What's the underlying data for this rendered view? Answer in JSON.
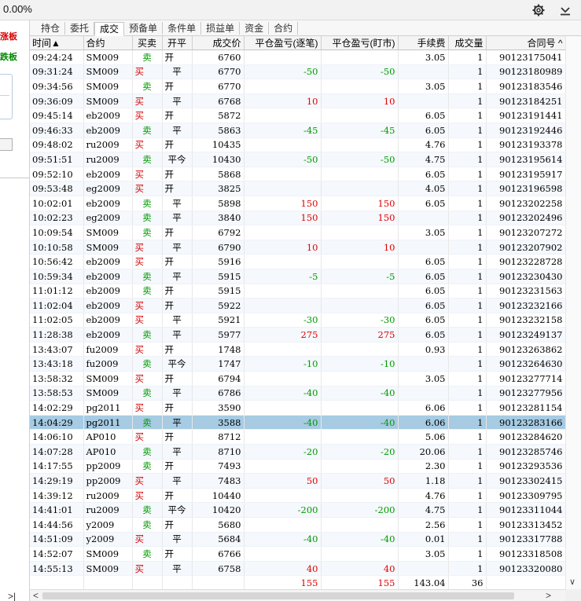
{
  "header": {
    "title": "0.00%"
  },
  "left_panel": {
    "up_label": "涨板",
    "down_label": "跌板",
    "chevron": ">|"
  },
  "tabs": [
    "持仓",
    "委托",
    "成交",
    "预备单",
    "条件单",
    "损益单",
    "资金",
    "合约"
  ],
  "active_tab": 2,
  "columns": [
    "时间▲",
    "合约",
    "买卖",
    "开平",
    "成交价",
    "平仓盈亏(逐笔)",
    "平仓盈亏(盯市)",
    "手续费",
    "成交量",
    "合同号 ^"
  ],
  "rows": [
    [
      "09:24:24",
      "SM009",
      "卖",
      "开",
      "6760",
      "",
      "",
      "3.05",
      "1",
      "90123175041"
    ],
    [
      "09:31:24",
      "SM009",
      "买",
      "平",
      "6770",
      "-50",
      "-50",
      "",
      "1",
      "90123180989"
    ],
    [
      "09:34:56",
      "SM009",
      "卖",
      "开",
      "6770",
      "",
      "",
      "3.05",
      "1",
      "90123183546"
    ],
    [
      "09:36:09",
      "SM009",
      "买",
      "平",
      "6768",
      "10",
      "10",
      "",
      "1",
      "90123184251"
    ],
    [
      "09:45:14",
      "eb2009",
      "买",
      "开",
      "5872",
      "",
      "",
      "6.05",
      "1",
      "90123191441"
    ],
    [
      "09:46:33",
      "eb2009",
      "卖",
      "平",
      "5863",
      "-45",
      "-45",
      "6.05",
      "1",
      "90123192446"
    ],
    [
      "09:48:02",
      "ru2009",
      "买",
      "开",
      "10435",
      "",
      "",
      "4.76",
      "1",
      "90123193378"
    ],
    [
      "09:51:51",
      "ru2009",
      "卖",
      "平今",
      "10430",
      "-50",
      "-50",
      "4.75",
      "1",
      "90123195614"
    ],
    [
      "09:52:10",
      "eb2009",
      "买",
      "开",
      "5868",
      "",
      "",
      "6.05",
      "1",
      "90123195917"
    ],
    [
      "09:53:48",
      "eg2009",
      "买",
      "开",
      "3825",
      "",
      "",
      "4.05",
      "1",
      "90123196598"
    ],
    [
      "10:02:01",
      "eb2009",
      "卖",
      "平",
      "5898",
      "150",
      "150",
      "6.05",
      "1",
      "90123202258"
    ],
    [
      "10:02:23",
      "eg2009",
      "卖",
      "平",
      "3840",
      "150",
      "150",
      "",
      "1",
      "90123202496"
    ],
    [
      "10:09:54",
      "SM009",
      "卖",
      "开",
      "6792",
      "",
      "",
      "3.05",
      "1",
      "90123207272"
    ],
    [
      "10:10:58",
      "SM009",
      "买",
      "平",
      "6790",
      "10",
      "10",
      "",
      "1",
      "90123207902"
    ],
    [
      "10:56:42",
      "eb2009",
      "买",
      "开",
      "5916",
      "",
      "",
      "6.05",
      "1",
      "90123228728"
    ],
    [
      "10:59:34",
      "eb2009",
      "卖",
      "平",
      "5915",
      "-5",
      "-5",
      "6.05",
      "1",
      "90123230430"
    ],
    [
      "11:01:12",
      "eb2009",
      "卖",
      "开",
      "5915",
      "",
      "",
      "6.05",
      "1",
      "90123231563"
    ],
    [
      "11:02:04",
      "eb2009",
      "买",
      "开",
      "5922",
      "",
      "",
      "6.05",
      "1",
      "90123232166"
    ],
    [
      "11:02:05",
      "eb2009",
      "买",
      "平",
      "5921",
      "-30",
      "-30",
      "6.05",
      "1",
      "90123232158"
    ],
    [
      "11:28:38",
      "eb2009",
      "卖",
      "平",
      "5977",
      "275",
      "275",
      "6.05",
      "1",
      "90123249137"
    ],
    [
      "13:43:07",
      "fu2009",
      "买",
      "开",
      "1748",
      "",
      "",
      "0.93",
      "1",
      "90123263862"
    ],
    [
      "13:43:18",
      "fu2009",
      "卖",
      "平今",
      "1747",
      "-10",
      "-10",
      "",
      "1",
      "90123264630"
    ],
    [
      "13:58:32",
      "SM009",
      "买",
      "开",
      "6794",
      "",
      "",
      "3.05",
      "1",
      "90123277714"
    ],
    [
      "13:58:53",
      "SM009",
      "卖",
      "平",
      "6786",
      "-40",
      "-40",
      "",
      "1",
      "90123277956"
    ],
    [
      "14:02:29",
      "pg2011",
      "买",
      "开",
      "3590",
      "",
      "",
      "6.06",
      "1",
      "90123281154"
    ],
    [
      "14:04:29",
      "pg2011",
      "卖",
      "平",
      "3588",
      "-40",
      "-40",
      "6.06",
      "1",
      "90123283166"
    ],
    [
      "14:06:10",
      "AP010",
      "买",
      "开",
      "8712",
      "",
      "",
      "5.06",
      "1",
      "90123284620"
    ],
    [
      "14:07:28",
      "AP010",
      "卖",
      "平",
      "8710",
      "-20",
      "-20",
      "20.06",
      "1",
      "90123285746"
    ],
    [
      "14:17:55",
      "pp2009",
      "卖",
      "开",
      "7493",
      "",
      "",
      "2.30",
      "1",
      "90123293536"
    ],
    [
      "14:29:19",
      "pp2009",
      "买",
      "平",
      "7483",
      "50",
      "50",
      "1.18",
      "1",
      "90123302415"
    ],
    [
      "14:39:12",
      "ru2009",
      "买",
      "开",
      "10440",
      "",
      "",
      "4.76",
      "1",
      "90123309795"
    ],
    [
      "14:41:01",
      "ru2009",
      "卖",
      "平今",
      "10420",
      "-200",
      "-200",
      "4.75",
      "1",
      "90123311044"
    ],
    [
      "14:44:56",
      "y2009",
      "卖",
      "开",
      "5680",
      "",
      "",
      "2.56",
      "1",
      "90123313452"
    ],
    [
      "14:51:09",
      "y2009",
      "买",
      "平",
      "5684",
      "-40",
      "-40",
      "0.01",
      "1",
      "90123317788"
    ],
    [
      "14:52:07",
      "SM009",
      "卖",
      "开",
      "6766",
      "",
      "",
      "3.05",
      "1",
      "90123318508"
    ],
    [
      "14:55:13",
      "SM009",
      "买",
      "平",
      "6758",
      "40",
      "40",
      "",
      "1",
      "90123320080"
    ]
  ],
  "selected_row": 25,
  "totals": [
    "",
    "",
    "",
    "",
    "",
    "155",
    "155",
    "143.04",
    "36",
    ""
  ],
  "scroll": {
    "left": "<",
    "right": ">",
    "down": "∨"
  }
}
